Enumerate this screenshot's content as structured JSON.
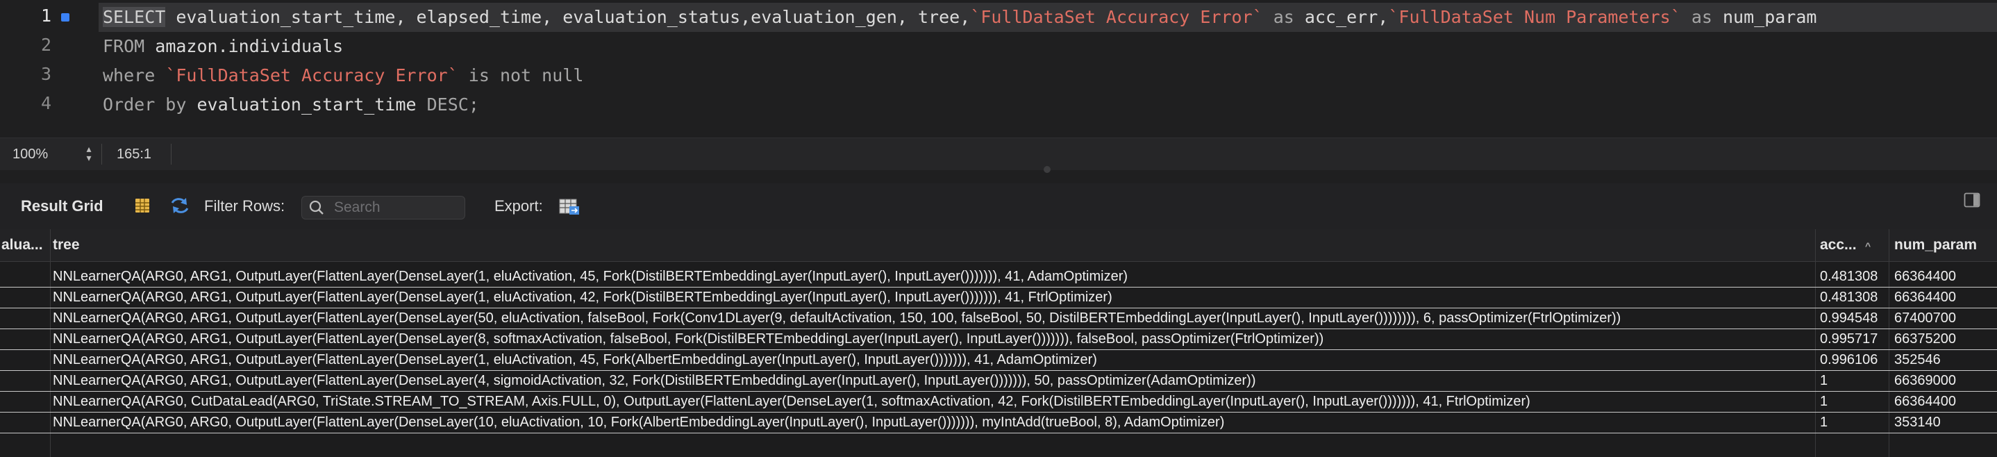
{
  "editor": {
    "line_numbers": [
      "1",
      "2",
      "3",
      "4"
    ],
    "line1": {
      "select": "SELECT",
      "cols": " evaluation_start_time, elapsed_time, evaluation_status,evaluation_gen, tree,",
      "acc_col": "`FullDataSet Accuracy Error`",
      "as1": " as ",
      "acc_alias": "acc_err,",
      "num_col": "`FullDataSet Num Parameters`",
      "as2": " as ",
      "num_alias": "num_param"
    },
    "line2": {
      "kw": "FROM",
      "rest": " amazon.individuals"
    },
    "line3": {
      "kw": "where ",
      "col": "`FullDataSet Accuracy Error`",
      "rest": " is not null"
    },
    "line4": {
      "kw": "Order by",
      "rest": " evaluation_start_time ",
      "desc": "DESC;"
    }
  },
  "status": {
    "zoom": "100%",
    "cursor_position": "165:1"
  },
  "toolbar": {
    "result_grid_label": "Result Grid",
    "filter_rows_label": "Filter Rows:",
    "search_placeholder": "Search",
    "export_label": "Export:"
  },
  "grid": {
    "columns": [
      "alua...",
      "tree",
      "acc...",
      "num_param"
    ],
    "rows": [
      {
        "tree": "NNLearnerQA(ARG0, ARG1, OutputLayer(FlattenLayer(DenseLayer(1, eluActivation, 45, Fork(DistilBERTEmbeddingLayer(InputLayer(), InputLayer())))))), 41, AdamOptimizer)",
        "acc": "0.481308",
        "num": "66364400"
      },
      {
        "tree": "NNLearnerQA(ARG0, ARG1, OutputLayer(FlattenLayer(DenseLayer(1, eluActivation, 42, Fork(DistilBERTEmbeddingLayer(InputLayer(), InputLayer())))))), 41, FtrlOptimizer)",
        "acc": "0.481308",
        "num": "66364400"
      },
      {
        "tree": "NNLearnerQA(ARG0, ARG1, OutputLayer(FlattenLayer(DenseLayer(50, eluActivation, falseBool, Fork(Conv1DLayer(9, defaultActivation, 150, 100, falseBool, 50, DistilBERTEmbeddingLayer(InputLayer(), InputLayer()))))))), 6, passOptimizer(FtrlOptimizer))",
        "acc": "0.994548",
        "num": "67400700"
      },
      {
        "tree": "NNLearnerQA(ARG0, ARG1, OutputLayer(FlattenLayer(DenseLayer(8, softmaxActivation, falseBool, Fork(DistilBERTEmbeddingLayer(InputLayer(), InputLayer())))))), falseBool, passOptimizer(FtrlOptimizer))",
        "acc": "0.995717",
        "num": "66375200"
      },
      {
        "tree": "NNLearnerQA(ARG0, ARG1, OutputLayer(FlattenLayer(DenseLayer(1, eluActivation, 45, Fork(AlbertEmbeddingLayer(InputLayer(), InputLayer())))))), 41, AdamOptimizer)",
        "acc": "0.996106",
        "num": "352546"
      },
      {
        "tree": "NNLearnerQA(ARG0, ARG1, OutputLayer(FlattenLayer(DenseLayer(4, sigmoidActivation, 32, Fork(DistilBERTEmbeddingLayer(InputLayer(), InputLayer())))))), 50, passOptimizer(AdamOptimizer))",
        "acc": "1",
        "num": "66369000"
      },
      {
        "tree": "NNLearnerQA(ARG0, CutDataLead(ARG0, TriState.STREAM_TO_STREAM, Axis.FULL, 0), OutputLayer(FlattenLayer(DenseLayer(1, softmaxActivation, 42, Fork(DistilBERTEmbeddingLayer(InputLayer(), InputLayer())))))), 41, FtrlOptimizer)",
        "acc": "1",
        "num": "66364400"
      },
      {
        "tree": "NNLearnerQA(ARG0, ARG0, OutputLayer(FlattenLayer(DenseLayer(10, eluActivation, 10, Fork(AlbertEmbeddingLayer(InputLayer(), InputLayer())))))), myIntAdd(trueBool, 8), AdamOptimizer)",
        "acc": "1",
        "num": "353140"
      }
    ]
  },
  "colors": {
    "accent": "#4a90e2",
    "string": "#e06e62",
    "background": "#1e1e1f"
  },
  "icons": [
    "grid-view-icon",
    "refresh-icon",
    "search-icon",
    "export-icon",
    "panel-toggle-icon",
    "sort-ascending-icon"
  ]
}
